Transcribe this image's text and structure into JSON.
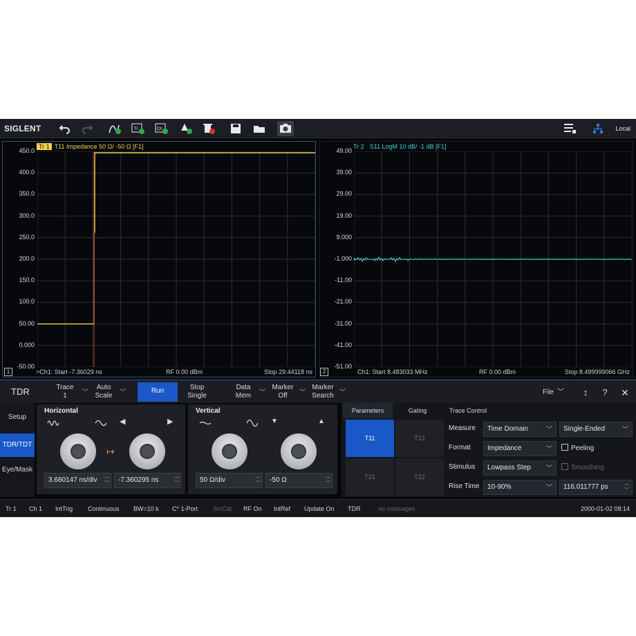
{
  "app": {
    "logo": "SIGLENT",
    "connection": "Local"
  },
  "toolbar": {
    "icons": [
      "undo-icon",
      "redo-icon",
      "add-trace-icon",
      "add-trace-window-icon",
      "add-channel-icon",
      "add-marker-icon",
      "delete-icon",
      "save-icon",
      "open-folder-icon",
      "screenshot-icon",
      "layout-icon",
      "network-icon"
    ]
  },
  "plot1": {
    "tag": "Tr 1",
    "title": "T11 Impedance 50 Ω/ -50 Ω [F1]",
    "y_labels": [
      "450.0",
      "400.0",
      "350.0",
      "300.0",
      "250.0",
      "200.0",
      "150.0",
      "100.0",
      "50.00",
      "0.000",
      "-50.00"
    ],
    "footer_left": ">Ch1: Start -7.36029 ns",
    "footer_mid": "RF 0.00 dBm",
    "footer_right": "Stop 29.44118 ns",
    "panel_num": "1",
    "color": "#f2d44c"
  },
  "plot2": {
    "tag": "Tr 2",
    "title": "S11 LogM 10 dB/ -1 dB [F1]",
    "y_labels": [
      "49.00",
      "39.00",
      "29.00",
      "19.00",
      "9.000",
      "-1.000",
      "-11.00",
      "-21.00",
      "-31.00",
      "-41.00",
      "-51.00"
    ],
    "footer_left": "Ch1: Start 8.483033 MHz",
    "footer_mid": "RF 0.00 dBm",
    "footer_right": "Stop 8.499999066 GHz",
    "panel_num": "2",
    "color": "#3fd7d7"
  },
  "control": {
    "title": "TDR",
    "trace": [
      "Trace",
      "1"
    ],
    "autoscale": [
      "Auto",
      "Scale"
    ],
    "run": "Run",
    "stop": [
      "Stop",
      "Single"
    ],
    "datamem": [
      "Data",
      "Mem"
    ],
    "marker": [
      "Marker",
      "Off"
    ],
    "markersearch": [
      "Marker",
      "Search"
    ],
    "file": "File"
  },
  "side": {
    "setup": "Setup",
    "tdr": "TDR/TDT",
    "eye": "Eye/Mask"
  },
  "horizontal": {
    "title": "Horizontal",
    "scale": "3.680147 ns/div",
    "offset": "-7.360295 ns"
  },
  "vertical": {
    "title": "Vertical",
    "scale": "50 Ω/div",
    "offset": "-50 Ω"
  },
  "rpanel": {
    "tabs": [
      "Parameters",
      "Gating",
      "Trace Control"
    ],
    "sparams": [
      "T11",
      "T12",
      "T21",
      "T22"
    ],
    "measure": {
      "label": "Measure",
      "value": "Time Domain",
      "mode": "Single-Ended"
    },
    "format": {
      "label": "Format",
      "value": "Impedance",
      "peeling": "Peeling"
    },
    "stimulus": {
      "label": "Stimulus",
      "value": "Lowpass Step",
      "smoothing": "Smoothing"
    },
    "rise": {
      "label": "Rise Time",
      "value": "10-90%",
      "time": "116.011777 ps"
    }
  },
  "status": [
    "Tr 1",
    "Ch 1",
    "IntTrig",
    "Continuous",
    "BW=10 k",
    "C* 1-Port",
    "SrcCal",
    "RF On",
    "IntRef",
    "Update On",
    "TDR",
    "no messages",
    "2000-01-02 08:14"
  ]
}
